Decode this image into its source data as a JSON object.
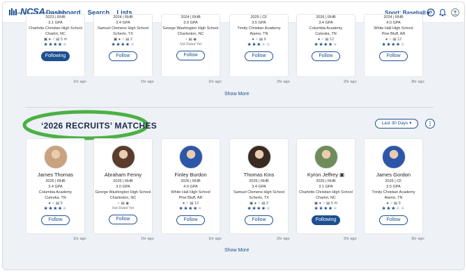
{
  "header": {
    "logo_text": "NCSA",
    "logo_sub": "NEXT COLLEGE STUDENT ATHLETE",
    "nav": [
      "Dashboard",
      "Search",
      "Lists"
    ],
    "sport_label": "Sport: Baseball ▾"
  },
  "top_cards": [
    {
      "lines": [
        "2023 | RHB",
        "3.1 GPA",
        "Charlotte Christian High School",
        "Charlot, NC"
      ],
      "icons": "▣ ● ♂ ▤ 5 ✉",
      "stars": 4,
      "not_rated": "",
      "button": "Following",
      "following": true,
      "ago": "1hr ago"
    },
    {
      "lines": [
        "2024 | RHB",
        "3.4 GPA",
        "Samuel Clemens High School",
        "Schertx, TX"
      ],
      "icons": "▣ ● ♂ ▤ 2",
      "stars": 4,
      "not_rated": "",
      "button": "Follow",
      "following": false,
      "ago": "1hr ago"
    },
    {
      "lines": [
        "2024 | RHB",
        "3.0 GPA",
        "George Washington High School",
        "Charleston, NC"
      ],
      "icons": "♂ ▤ ◉",
      "stars": 0,
      "not_rated": "Not Rated Yet",
      "button": "Follow",
      "following": false,
      "ago": "1hr ago"
    },
    {
      "lines": [
        "2025 | CF",
        "3.5 GPA",
        "Trinity Christian Academy",
        "Alamo, TN"
      ],
      "icons": "● ♂ ▤ 9",
      "stars": 3,
      "not_rated": "",
      "button": "Follow",
      "following": false,
      "ago": "2hr ago"
    },
    {
      "lines": [
        "2026 | RHB",
        "3.4 GPA",
        "Columbia Academy",
        "Culeoka, TN"
      ],
      "icons": "● ♂ ▤ 12",
      "stars": 4,
      "not_rated": "",
      "button": "Follow",
      "following": false,
      "ago": "2hr ago"
    },
    {
      "lines": [
        "2024 | RHB",
        "4.0 GPA",
        "White Hall High School",
        "Pine Bluff, AR"
      ],
      "icons": "● ♂ ▤ 12",
      "stars": 4,
      "not_rated": "",
      "button": "Follow",
      "following": false,
      "ago": "3hr ago"
    }
  ],
  "show_more": "Show More",
  "section": {
    "title": "‘2026 RECRUITS’ MATCHES",
    "filter": "Last 30 Days ▾"
  },
  "bottom_cards": [
    {
      "name": "James Thomas",
      "lines": [
        "2026 | RHB",
        "3.4 GPA",
        "Columbia Academy",
        "Culeoka, TN"
      ],
      "icons": "● ♂ ▤ 5",
      "stars": 4,
      "not_rated": "",
      "button": "Follow",
      "following": false,
      "ago": "1hr ago",
      "avatar_color": "#c9a27e"
    },
    {
      "name": "Abraham Fenny",
      "lines": [
        "2026 | RHB",
        "3.0 GPA",
        "George Washington High School",
        "Charleston, NC"
      ],
      "icons": "♂ ▤ ◉",
      "stars": 0,
      "not_rated": "Not Rated Yet",
      "button": "Follow",
      "following": false,
      "ago": "1hr ago",
      "avatar_color": "#5a3b2c"
    },
    {
      "name": "Finley Burdon",
      "lines": [
        "2026 | RHB",
        "4.0 GPA",
        "White Hall High School",
        "Pine Bluff, AR"
      ],
      "icons": "● ♂ ▤ 12",
      "stars": 4,
      "not_rated": "",
      "button": "Follow",
      "following": false,
      "ago": "1hr ago",
      "avatar_color": "#2e56a8"
    },
    {
      "name": "Thomas Kins",
      "lines": [
        "2026 | RHB",
        "3.4 GPA",
        "Samuel Clemens High School",
        "Schertx, TX"
      ],
      "icons": "▣ ● ♂ ▤ 2",
      "stars": 4,
      "not_rated": "",
      "button": "Follow",
      "following": false,
      "ago": "2hr ago",
      "avatar_color": "#3a2a22"
    },
    {
      "name": "Kyron Jeffrey ▣",
      "lines": [
        "2026 | RHB",
        "3.1 GPA",
        "Charlotte Christian High School",
        "Charlot, NC"
      ],
      "icons": "▣ ● ♂ ▤ 5 ✉",
      "stars": 4,
      "not_rated": "",
      "button": "Following",
      "following": true,
      "ago": "2hr ago",
      "avatar_color": "#6f8c5a"
    },
    {
      "name": "James Gordon",
      "lines": [
        "2026 | CF",
        "3.5 GPA",
        "Trinity Christian Academy",
        "Alamo, TN"
      ],
      "icons": "● ♂ ▤ 9",
      "stars": 3,
      "not_rated": "",
      "button": "Follow",
      "following": false,
      "ago": "3hr ago",
      "avatar_color": "#2e56a8"
    }
  ],
  "colors": {
    "brand": "#1d4f91",
    "highlight": "#4cb044"
  }
}
